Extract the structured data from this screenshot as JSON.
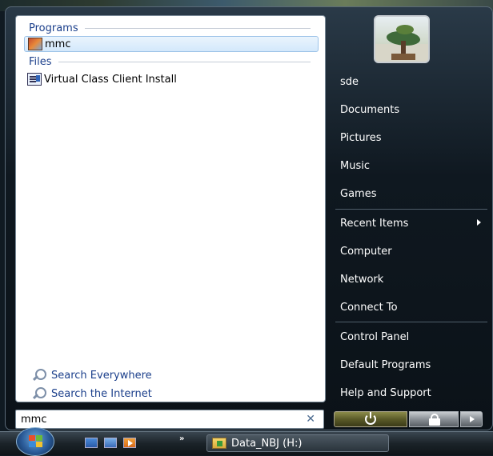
{
  "search": {
    "query": "mmc",
    "clear_icon": "clear-icon"
  },
  "results": {
    "programs_header": "Programs",
    "programs": [
      {
        "label": "mmc",
        "icon": "mmc-icon",
        "selected": true
      }
    ],
    "files_header": "Files",
    "files": [
      {
        "label": "Virtual Class Client Install",
        "icon": "document-icon"
      }
    ]
  },
  "search_links": [
    {
      "label": "Search Everywhere",
      "icon": "search-icon"
    },
    {
      "label": "Search the Internet",
      "icon": "search-icon"
    }
  ],
  "right_pane": {
    "user_name": "sde",
    "items": [
      {
        "label": "Documents"
      },
      {
        "label": "Pictures"
      },
      {
        "label": "Music"
      },
      {
        "label": "Games"
      },
      {
        "label": "Recent Items",
        "has_submenu": true
      },
      {
        "label": "Computer"
      },
      {
        "label": "Network"
      },
      {
        "label": "Connect To"
      },
      {
        "label": "Control Panel"
      },
      {
        "label": "Default Programs"
      },
      {
        "label": "Help and Support"
      }
    ]
  },
  "power": {
    "power_icon": "power-icon",
    "lock_icon": "lock-icon",
    "options_icon": "arrow-right-icon"
  },
  "taskbar": {
    "more_label": "»",
    "task_label": "Data_NBJ (H:)"
  }
}
